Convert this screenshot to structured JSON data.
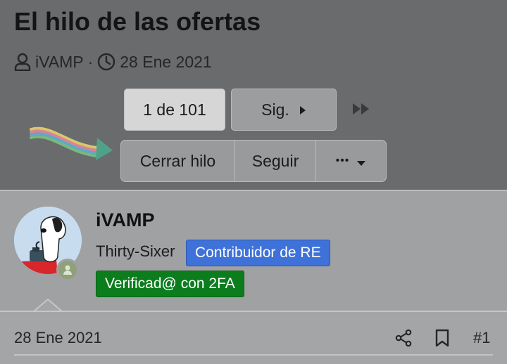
{
  "thread": {
    "title": "El hilo de las ofertas",
    "author": "iVAMP",
    "separator": "·",
    "date": "28 Ene 2021"
  },
  "pagination": {
    "current": "1 de 101",
    "next_label": "Sig.",
    "last_page_icon": "double-chevron-right-icon"
  },
  "actions": {
    "close_label": "Cerrar hilo",
    "follow_label": "Seguir",
    "more_label": "•••"
  },
  "post": {
    "username": "iVAMP",
    "user_title": "Thirty-Sixer",
    "badges": [
      {
        "label": "Contribuidor de RE",
        "color": "#3f72d8"
      },
      {
        "label": "Verificad@ con 2FA",
        "color": "#0b7d1d"
      }
    ],
    "date": "28 Ene 2021",
    "number": "#1"
  },
  "colors": {
    "header_bg": "#6a6b6d",
    "post_bg": "#a0a1a2"
  }
}
